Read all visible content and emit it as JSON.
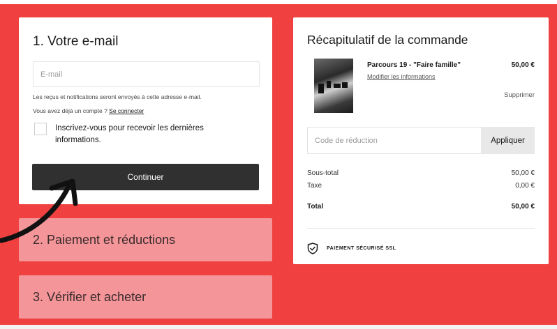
{
  "email_section": {
    "title": "1. Votre e-mail",
    "email_placeholder": "E-mail",
    "receipt_note": "Les reçus et notifications seront envoyés à cette adresse e-mail.",
    "account_question": "Vous avez déjà un compte ?",
    "login_link": "Se connecter",
    "newsletter_label": "Inscrivez-vous pour recevoir les dernières informations.",
    "newsletter_checked": false,
    "continue_label": "Continuer"
  },
  "payment_section": {
    "title": "2. Paiement et réductions"
  },
  "review_section": {
    "title": "3. Vérifier et acheter"
  },
  "summary": {
    "title": "Récapitulatif de la commande",
    "product": {
      "name": "Parcours 19 - \"Faire famille\"",
      "price": "50,00 €",
      "edit_link": "Modifier les informations",
      "remove_link": "Supprimer"
    },
    "promo_placeholder": "Code de réduction",
    "apply_label": "Appliquer",
    "subtotal_label": "Sous-total",
    "subtotal_value": "50,00 €",
    "tax_label": "Taxe",
    "tax_value": "0,00 €",
    "total_label": "Total",
    "total_value": "50,00 €",
    "secure_label": "PAIEMENT SÉCURISÉ SSL"
  },
  "colors": {
    "background": "#f0403f",
    "inactive_step": "#f39599",
    "button_dark": "#303030"
  },
  "icons": {
    "shield": "shield-check-icon",
    "arrow": "curved-arrow-icon"
  }
}
